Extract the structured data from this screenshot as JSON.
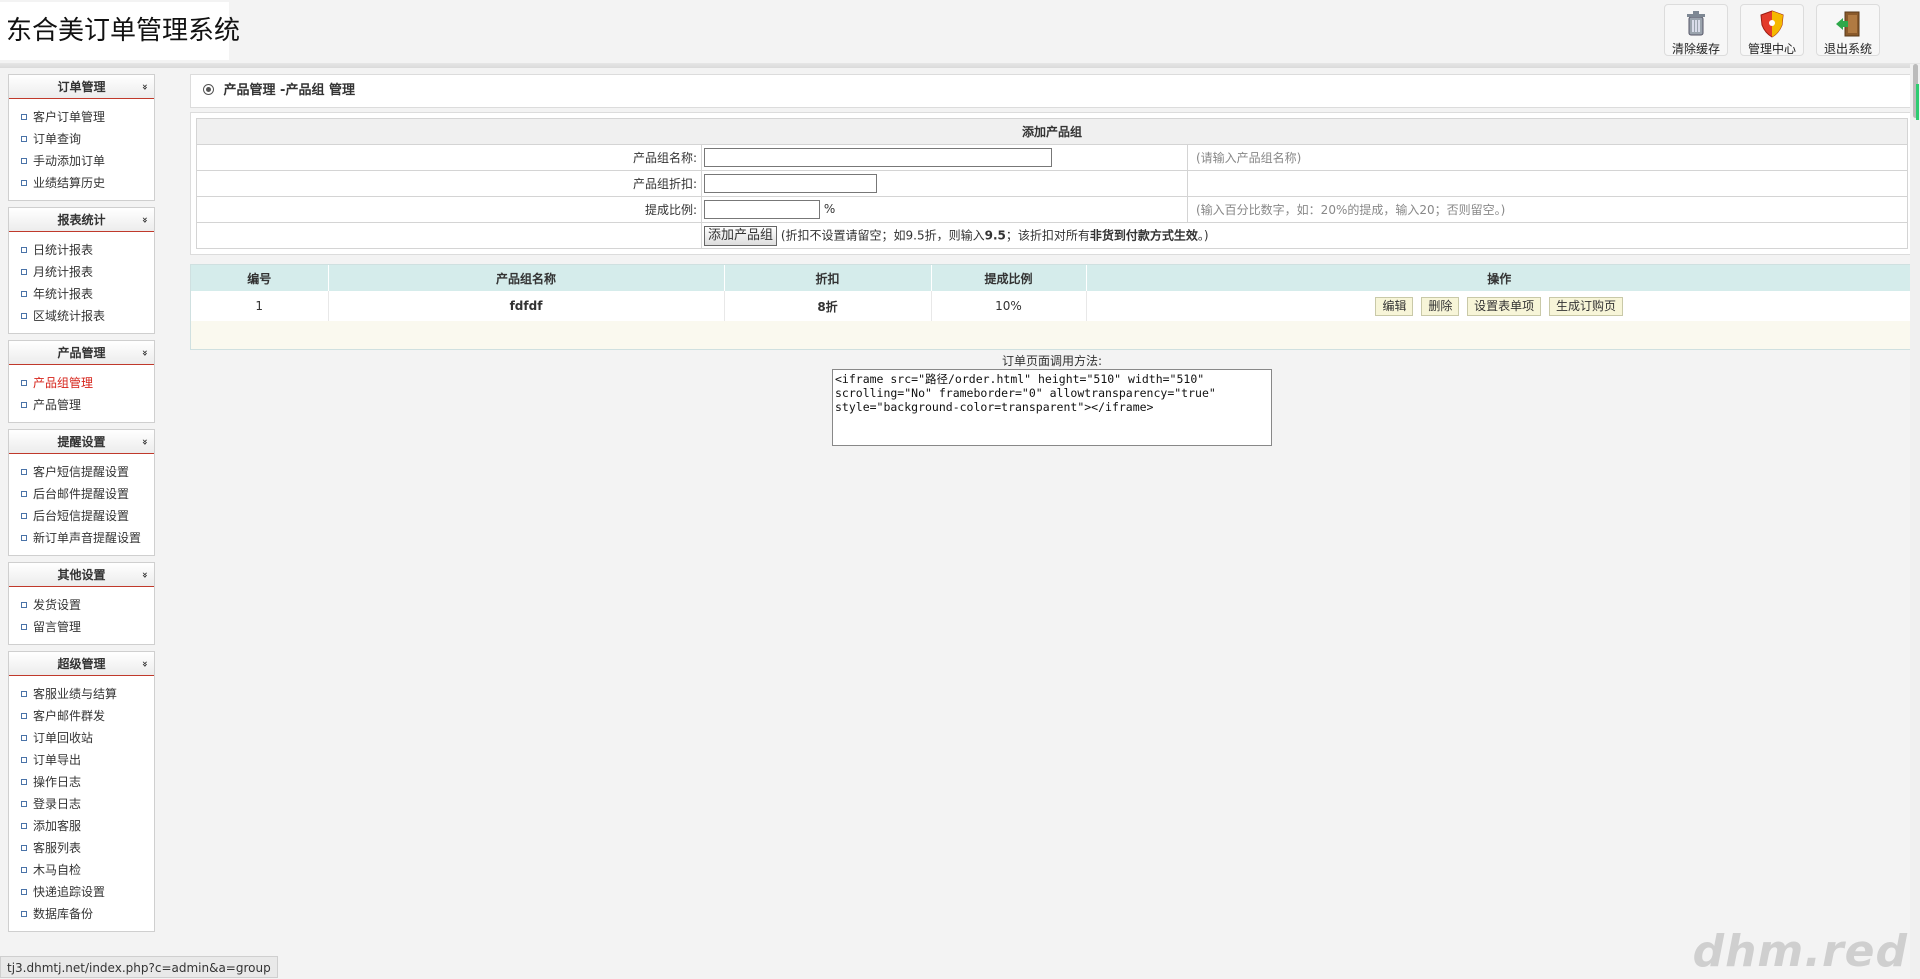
{
  "header": {
    "logo_text": "东合美订单管理系统",
    "buttons": [
      {
        "label": "清除缓存",
        "icon": "trash-icon"
      },
      {
        "label": "管理中心",
        "icon": "shield-icon"
      },
      {
        "label": "退出系统",
        "icon": "exit-door-icon"
      }
    ]
  },
  "sidebar": {
    "groups": [
      {
        "title": "订单管理",
        "items": [
          "客户订单管理",
          "订单查询",
          "手动添加订单",
          "业绩结算历史"
        ]
      },
      {
        "title": "报表统计",
        "items": [
          "日统计报表",
          "月统计报表",
          "年统计报表",
          "区域统计报表"
        ]
      },
      {
        "title": "产品管理",
        "items": [
          "产品组管理",
          "产品管理"
        ],
        "active_item": "产品组管理"
      },
      {
        "title": "提醒设置",
        "items": [
          "客户短信提醒设置",
          "后台邮件提醒设置",
          "后台短信提醒设置",
          "新订单声音提醒设置"
        ]
      },
      {
        "title": "其他设置",
        "items": [
          "发货设置",
          "留言管理"
        ]
      },
      {
        "title": "超级管理",
        "items": [
          "客服业绩与结算",
          "客户邮件群发",
          "订单回收站",
          "订单导出",
          "操作日志",
          "登录日志",
          "添加客服",
          "客服列表",
          "木马自检",
          "快递追踪设置",
          "数据库备份"
        ]
      }
    ],
    "chevron_symbol": "»"
  },
  "main": {
    "title": "产品管理 -产品组 管理",
    "form": {
      "heading": "添加产品组",
      "name_label": "产品组名称:",
      "name_value": "",
      "name_hint": "(请输入产品组名称)",
      "discount_label": "产品组折扣:",
      "discount_value": "",
      "commission_label": "提成比例:",
      "commission_value": "",
      "commission_unit": "%",
      "commission_hint": "(输入百分比数字，如：20%的提成，输入20；否则留空。)",
      "submit_label": "添加产品组",
      "note_prefix": "(折扣不设置请留空；如9.5折，则输入",
      "note_bold1": "9.5",
      "note_mid": "；该折扣对所有",
      "note_bold2": "非货到付款方式生效",
      "note_suffix": "。)"
    },
    "table": {
      "headers": [
        "编号",
        "产品组名称",
        "折扣",
        "提成比例",
        "操作"
      ],
      "rows": [
        {
          "id": "1",
          "name": "fdfdf",
          "discount": "8折",
          "commission": "10%"
        }
      ],
      "actions": [
        "编辑",
        "删除",
        "设置表单项",
        "生成订购页"
      ]
    },
    "embed": {
      "label": "订单页面调用方法:",
      "code": "<iframe src=\"路径/order.html\" height=\"510\" width=\"510\"\nscrolling=\"No\" frameborder=\"0\" allowtransparency=\"true\"\nstyle=\"background-color=transparent\"></iframe>"
    }
  },
  "statusbar": {
    "url": "tj3.dhmtj.net/index.php?c=admin&a=group"
  },
  "watermark": "dhm.red",
  "colors": {
    "accent_red": "#d6231a",
    "table_header": "#d5eceb",
    "action_button_bg": "#f7f5d8"
  }
}
